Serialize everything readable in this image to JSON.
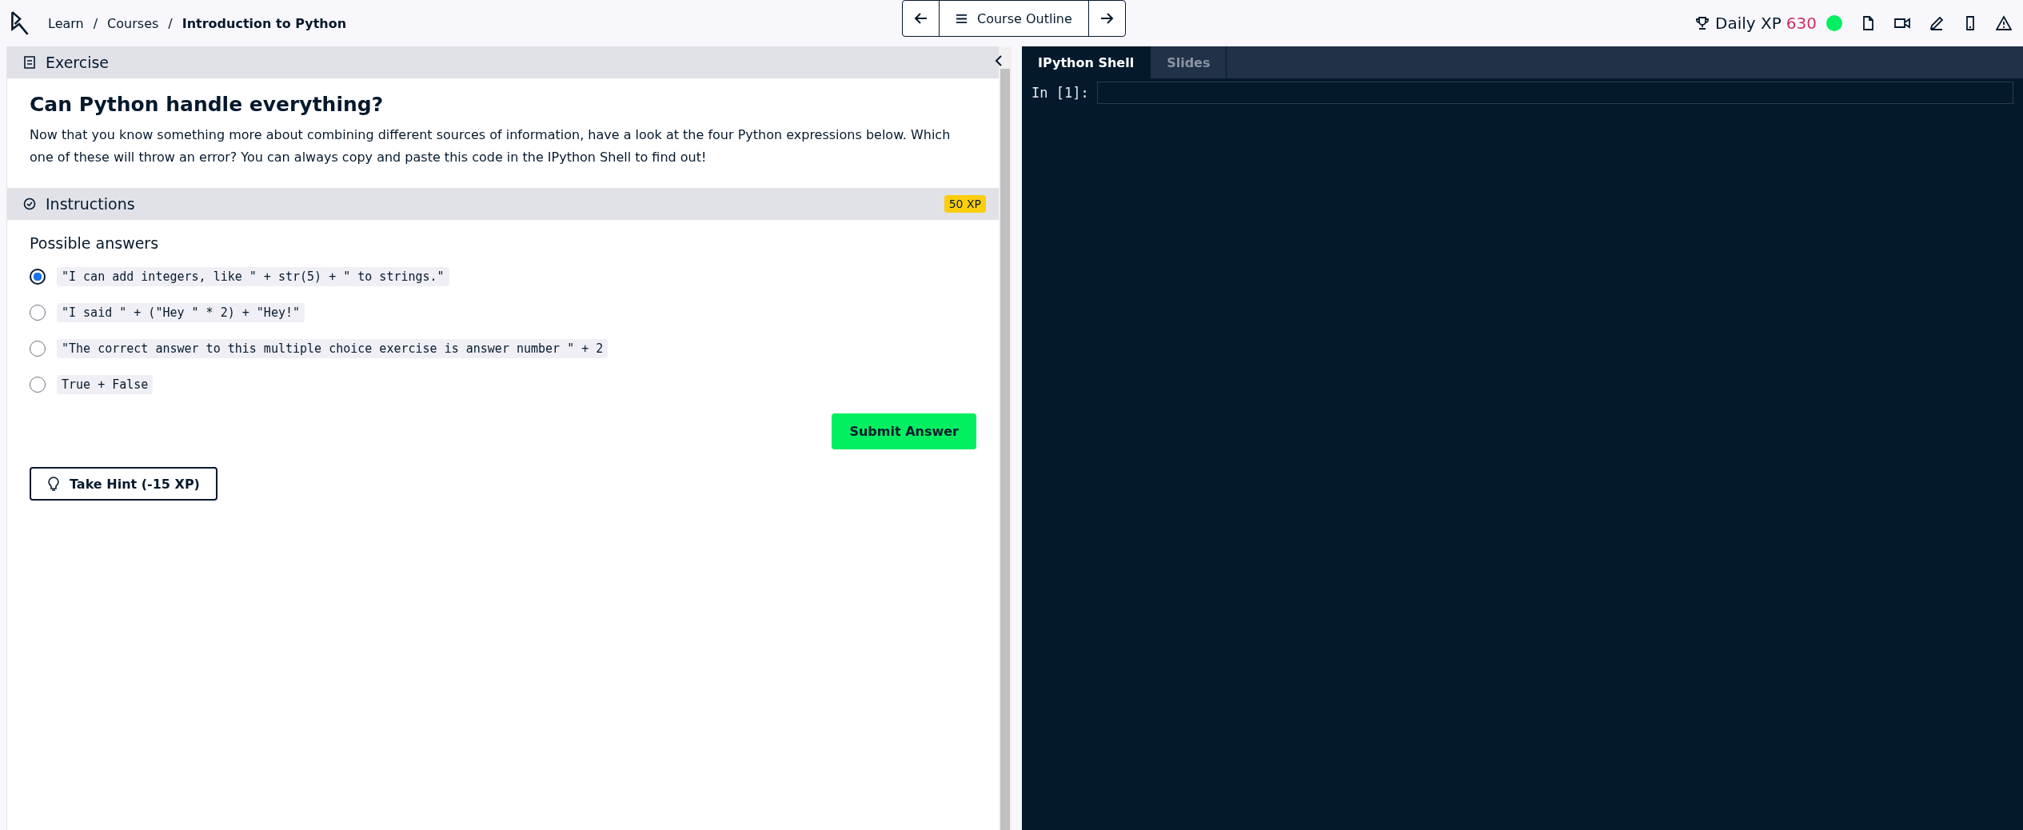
{
  "breadcrumbs": [
    {
      "label": "Learn",
      "current": false
    },
    {
      "label": "Courses",
      "current": false
    },
    {
      "label": "Introduction to Python",
      "current": true
    }
  ],
  "breadcrumb_separator": "/",
  "course_nav": {
    "outline_label": "Course Outline"
  },
  "daily_xp": {
    "label": "Daily XP",
    "value": "630"
  },
  "exercise": {
    "header": "Exercise",
    "title": "Can Python handle everything?",
    "description": "Now that you know something more about combining different sources of information, have a look at the four Python expressions below. Which one of these will throw an error? You can always copy and paste this code in the IPython Shell to find out!"
  },
  "instructions": {
    "header": "Instructions",
    "xp_badge": "50 XP",
    "answers_label": "Possible answers",
    "answers": [
      {
        "code": "\"I can add integers, like \" + str(5) + \" to strings.\"",
        "selected": true
      },
      {
        "code": "\"I said \" + (\"Hey \" * 2) + \"Hey!\"",
        "selected": false
      },
      {
        "code": "\"The correct answer to this multiple choice exercise is answer number \" + 2",
        "selected": false
      },
      {
        "code": "True + False",
        "selected": false
      }
    ],
    "submit_label": "Submit Answer",
    "hint_label": "Take Hint (-15 XP)"
  },
  "console": {
    "tabs": [
      {
        "label": "IPython Shell",
        "selected": true
      },
      {
        "label": "Slides",
        "selected": false
      }
    ],
    "prompt": "In [1]:"
  }
}
